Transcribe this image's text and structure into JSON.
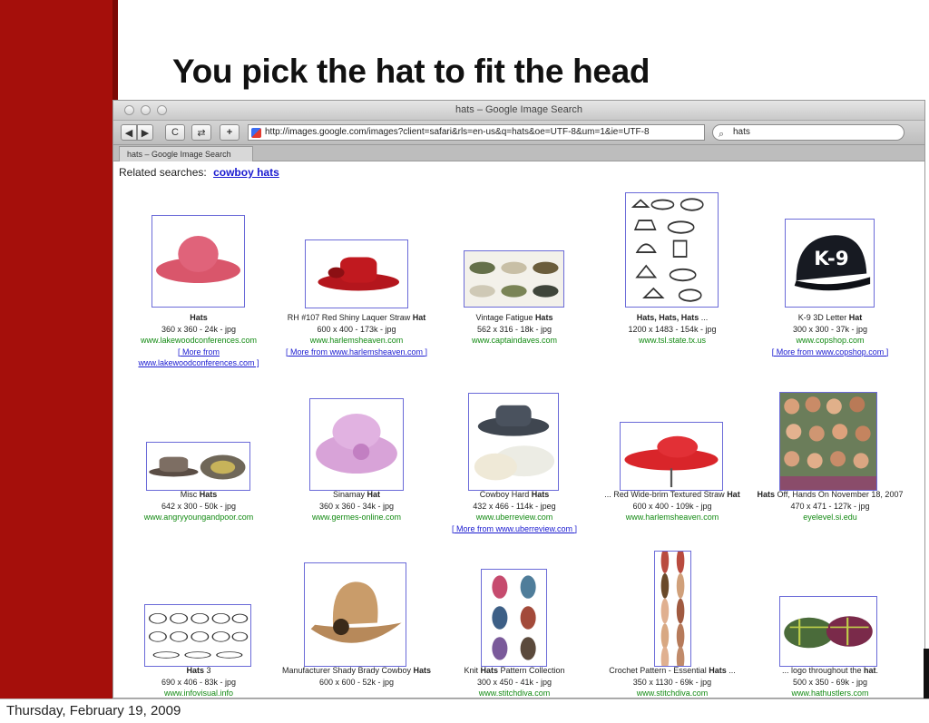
{
  "slide": {
    "title": "You pick the hat to fit the head",
    "footer_date": "Thursday, February 19, 2009"
  },
  "browser": {
    "window_title": "hats – Google Image Search",
    "url": "http://images.google.com/images?client=safari&rls=en-us&q=hats&oe=UTF-8&um=1&ie=UTF-8",
    "search_value": "hats",
    "tab_label": "hats – Google Image Search",
    "buttons": {
      "back": "◀",
      "forward": "▶",
      "reload": "C",
      "snapback": "⇄",
      "add": "+"
    }
  },
  "page": {
    "related_label": "Related searches:",
    "related_link": "cowboy hats"
  },
  "results": [
    {
      "icon": "pink-hat",
      "pre": "",
      "bold": "Hats",
      "post": "",
      "meta": "360 x 360 - 24k - jpg",
      "host": "www.lakewoodconferences.com",
      "more": "[ More from www.lakewoodconferences.com ]"
    },
    {
      "icon": "red-straw-hat",
      "pre": "RH #107 Red Shiny Laquer Straw",
      "bold": "Hat",
      "post": "",
      "meta": "600 x 400 - 173k - jpg",
      "host": "www.harlemsheaven.com",
      "more": "[ More from www.harlemsheaven.com ]"
    },
    {
      "icon": "fatigue-caps",
      "pre": "Vintage Fatigue",
      "bold": "Hats",
      "post": "",
      "meta": "562 x 316 - 18k - jpg",
      "host": "www.captaindaves.com",
      "more": ""
    },
    {
      "icon": "hat-sketches",
      "pre": "",
      "bold": "Hats, Hats, Hats",
      "post": " ...",
      "meta": "1200 x 1483 - 154k - jpg",
      "host": "www.tsl.state.tx.us",
      "more": ""
    },
    {
      "icon": "k9-cap",
      "pre": "K-9 3D Letter",
      "bold": "Hat",
      "post": "",
      "meta": "300 x 300 - 37k - jpg",
      "host": "www.copshop.com",
      "more": "[ More from www.copshop.com ]"
    },
    {
      "icon": "plaid-fedoras",
      "pre": "Misc",
      "bold": "Hats",
      "post": "",
      "meta": "642 x 300 - 50k - jpg",
      "host": "www.angryyoungandpoor.com",
      "more": ""
    },
    {
      "icon": "sinamay-hat",
      "pre": "Sinamay",
      "bold": "Hat",
      "post": "",
      "meta": "360 x 360 - 34k - jpg",
      "host": "www.germes-online.com",
      "more": ""
    },
    {
      "icon": "cowboy-hard-hats",
      "pre": "Cowboy Hard",
      "bold": "Hats",
      "post": "",
      "meta": "432 x 466 - 114k - jpeg",
      "host": "www.uberreview.com",
      "more": "[ More from www.uberreview.com ]"
    },
    {
      "icon": "red-wide-brim-hat",
      "pre": "... Red Wide-brim Textured Straw",
      "bold": "Hat",
      "post": "",
      "meta": "600 x 400 - 109k - jpg",
      "host": "www.harlemsheaven.com",
      "more": ""
    },
    {
      "icon": "crowd-photo",
      "pre": "",
      "bold": "Hats",
      "post": " Off, Hands On November 18, 2007",
      "meta": "470 x 471 - 127k - jpg",
      "host": "eyelevel.si.edu",
      "more": ""
    },
    {
      "icon": "hat-drawings",
      "pre": "",
      "bold": "Hats",
      "post": " 3",
      "meta": "690 x 406 - 83k - jpg",
      "host": "www.infovisual.info",
      "more": ""
    },
    {
      "icon": "straw-cowboy-hat",
      "pre": "Manufacturer Shady Brady Cowboy",
      "bold": "Hats",
      "post": "",
      "meta": "600 x 600 - 52k - jpg",
      "host": "",
      "more": ""
    },
    {
      "icon": "knit-hats",
      "pre": "Knit",
      "bold": "Hats",
      "post": " Pattern Collection",
      "meta": "300 x 450 - 41k - jpg",
      "host": "www.stitchdiva.com",
      "more": ""
    },
    {
      "icon": "crochet-pattern",
      "pre": "Crochet Pattern - Essential",
      "bold": "Hats",
      "post": " ...",
      "meta": "350 x 1130 - 69k - jpg",
      "host": "www.stitchdiva.com",
      "more": ""
    },
    {
      "icon": "plaid-caps",
      "pre": "... logo throughout the",
      "bold": "hat",
      "post": ".",
      "meta": "500 x 350 - 69k - jpg",
      "host": "www.hathustlers.com",
      "more": ""
    }
  ]
}
